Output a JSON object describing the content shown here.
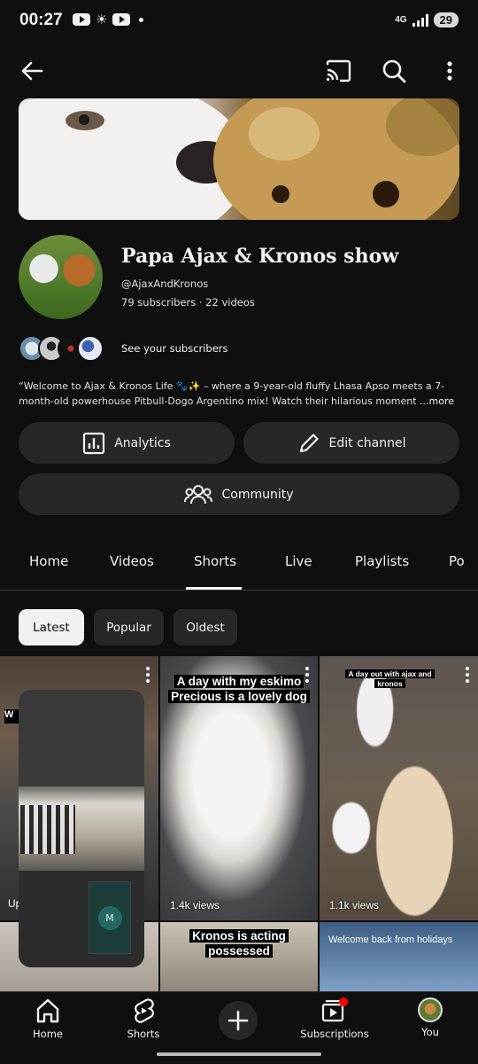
{
  "status_bar": {
    "time": "00:27",
    "network": "4G",
    "battery": "29"
  },
  "channel": {
    "title": "Papa Ajax & Kronos show",
    "handle": "@AjaxAndKronos",
    "stats": "79 subscribers · 22 videos",
    "see_subscribers": "See your subscribers",
    "description": "“Welcome to Ajax & Kronos Life 🐾✨ – where a 9-year-old fluffy Lhasa Apso meets a 7-month-old powerhouse Pitbull-Dogo Argentino mix! Watch their hilarious moments",
    "more": "...more"
  },
  "buttons": {
    "analytics": "Analytics",
    "edit": "Edit channel",
    "community": "Community"
  },
  "tabs": [
    "Home",
    "Videos",
    "Shorts",
    "Live",
    "Playlists",
    "Po"
  ],
  "active_tab": "Shorts",
  "chips": [
    "Latest",
    "Popular",
    "Oldest"
  ],
  "active_chip": "Latest",
  "shorts": [
    {
      "caption": "",
      "views": ""
    },
    {
      "caption_line1": "A day with my eskimo",
      "caption_line2": "Precious is a lovely dog",
      "views": "1.4k views"
    },
    {
      "caption_line1": "A day out with ajax and",
      "caption_line2": "kronos",
      "views": "1.1k views"
    },
    {
      "caption": ""
    },
    {
      "caption_line1": "Kronos is acting",
      "caption_line2": "possessed"
    },
    {
      "caption": "Welcome back from holidays"
    }
  ],
  "overlay": {
    "w_label": "W",
    "up_label": "Up",
    "m_label": "M"
  },
  "bottom_nav": {
    "home": "Home",
    "shorts": "Shorts",
    "subscriptions": "Subscriptions",
    "you": "You"
  },
  "colors": {
    "background": "#0f0f0f",
    "surface": "#272727",
    "notification": "#ff0000"
  }
}
